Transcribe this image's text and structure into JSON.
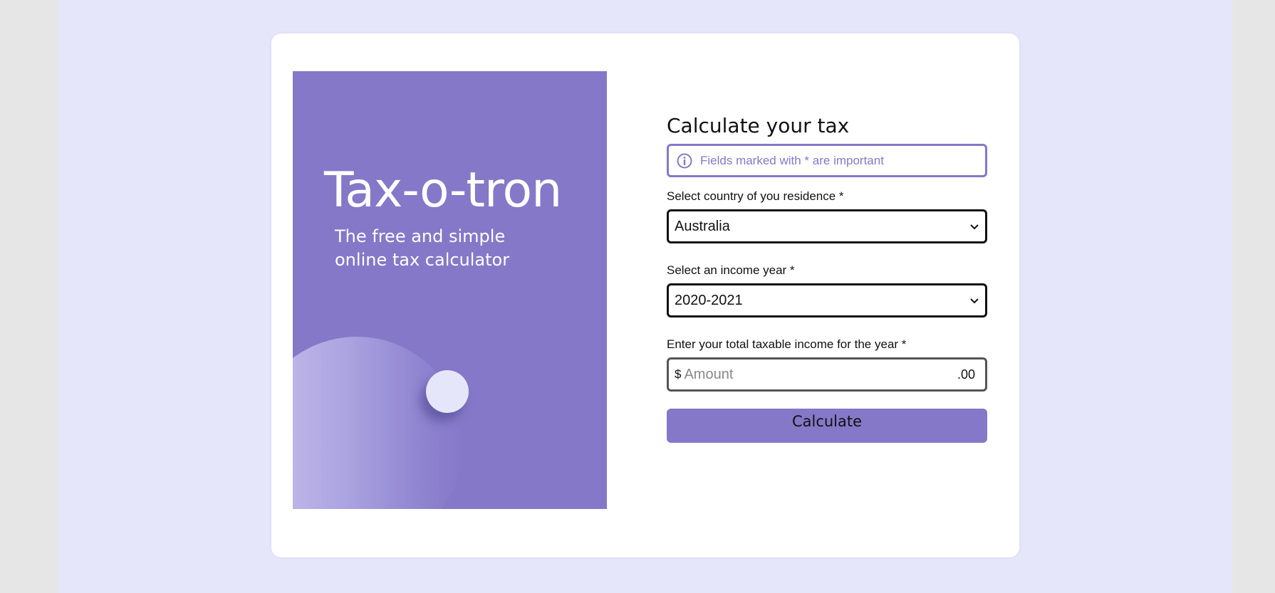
{
  "hero": {
    "title": "Tax-o-tron",
    "subtitle": "The free and simple online tax calculator"
  },
  "form": {
    "title": "Calculate your tax",
    "notice": "Fields marked with * are important",
    "country": {
      "label": "Select country of you residence *",
      "value": "Australia"
    },
    "year": {
      "label": "Select an income year *",
      "value": "2020-2021"
    },
    "income": {
      "label": "Enter your total taxable income for the year *",
      "currency": "$",
      "placeholder": "Amount",
      "value": "",
      "cents": ".00"
    },
    "submit_label": "Calculate"
  },
  "colors": {
    "accent": "#8578c8",
    "page_background": "#e6e6fa",
    "card_background": "#ffffff"
  },
  "icons": {
    "notice": "info-icon",
    "select": "chevron-down-icon"
  }
}
